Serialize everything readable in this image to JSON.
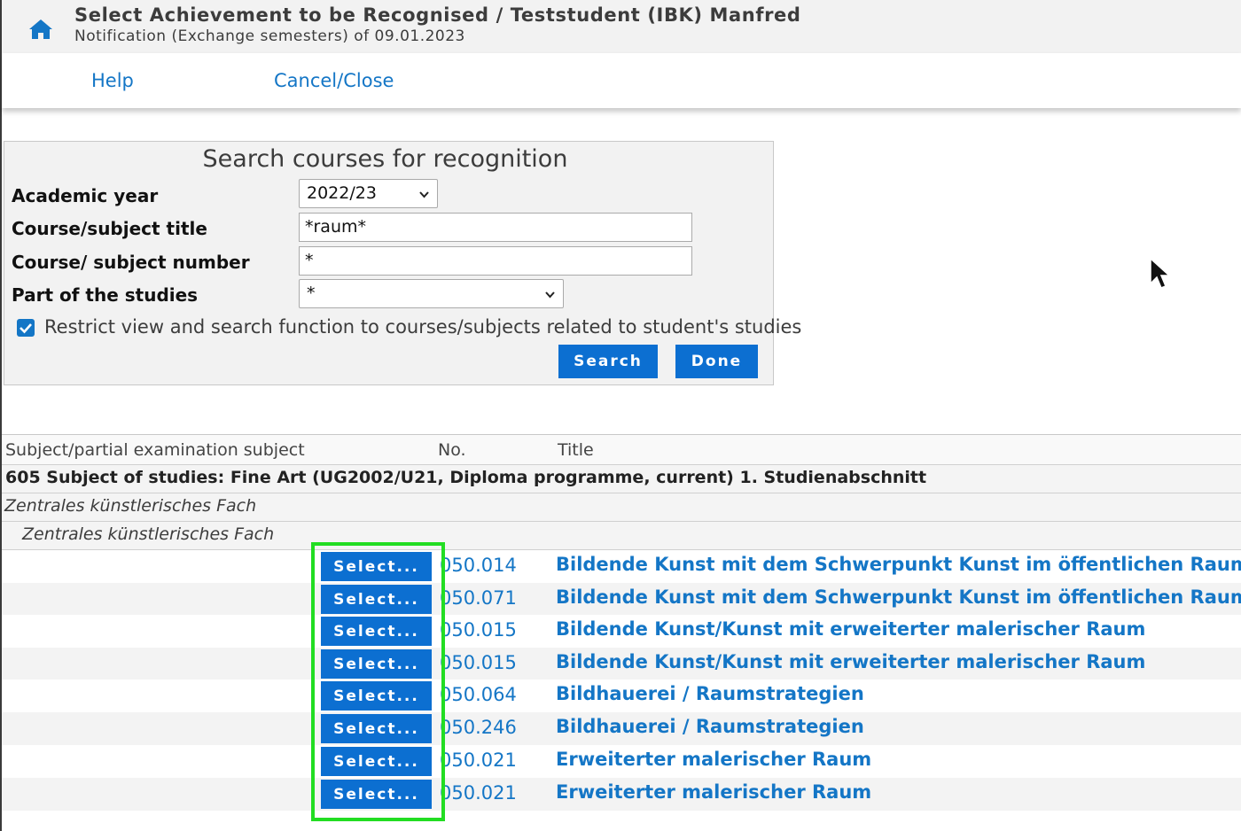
{
  "header": {
    "title": "Select Achievement to be Recognised  / Teststudent (IBK) Manfred",
    "subtitle": "Notification (Exchange semesters) of 09.01.2023"
  },
  "menu": {
    "help": "Help",
    "cancel": "Cancel/Close"
  },
  "search": {
    "title": "Search courses for recognition",
    "labels": {
      "year": "Academic year",
      "course_title": "Course/subject title",
      "course_number": "Course/ subject number",
      "part": "Part of the studies"
    },
    "year_value": "2022/23",
    "course_title_value": "*raum*",
    "course_number_value": "*",
    "part_value": "*",
    "restrict_label": "Restrict view and search function to courses/subjects related to student's studies",
    "restrict_checked": true,
    "search_button": "Search",
    "done_button": "Done"
  },
  "results": {
    "headers": {
      "subject": "Subject/partial examination subject",
      "no": "No.",
      "title": "Title"
    },
    "group1": "605 Subject of studies: Fine Art (UG2002/U21, Diploma programme, current) 1. Studienabschnitt",
    "group2": "Zentrales künstlerisches Fach",
    "group3": "Zentrales künstlerisches Fach",
    "select_label": "Select...",
    "rows": [
      {
        "no": "050.014",
        "title": "Bildende Kunst mit dem Schwerpunkt Kunst im öffentlichen Raum"
      },
      {
        "no": "050.071",
        "title": "Bildende Kunst mit dem Schwerpunkt Kunst im öffentlichen Raum"
      },
      {
        "no": "050.015",
        "title": "Bildende Kunst/Kunst mit erweiterter malerischer Raum"
      },
      {
        "no": "050.015",
        "title": "Bildende Kunst/Kunst mit erweiterter malerischer Raum"
      },
      {
        "no": "050.064",
        "title": "Bildhauerei / Raumstrategien"
      },
      {
        "no": "050.246",
        "title": "Bildhauerei / Raumstrategien"
      },
      {
        "no": "050.021",
        "title": "Erweiterter malerischer Raum"
      },
      {
        "no": "050.021",
        "title": "Erweiterter malerischer Raum"
      }
    ]
  },
  "colors": {
    "link": "#1476c6",
    "button": "#0c6fd1",
    "highlight": "#22dd22",
    "header_bg": "#f2f2f2"
  }
}
